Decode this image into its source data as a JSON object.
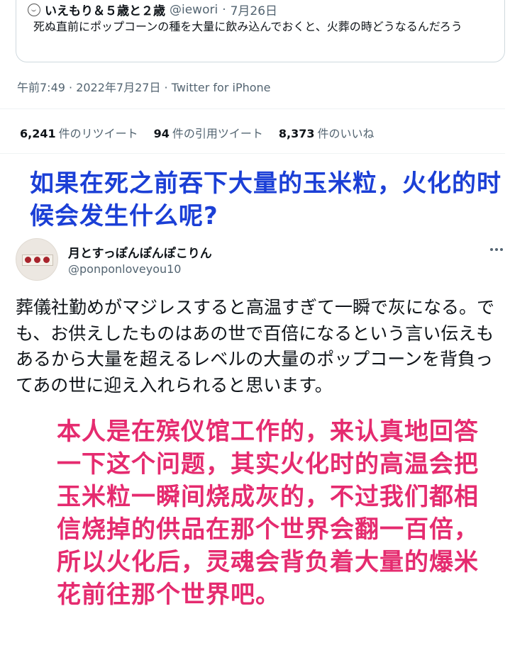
{
  "quoted_tweet": {
    "author_name": "いえもり＆５歳と２歳",
    "handle": "@iewori",
    "separator": "·",
    "date": "7月26日",
    "text": "死ぬ直前にポップコーンの種を大量に飲み込んでおくと、火葬の時どうなるんだろう"
  },
  "tweet_meta": {
    "timestamp": "午前7:49 · 2022年7月27日 · Twitter for iPhone",
    "retweets_count": "6,241",
    "retweets_label": "件のリツイート",
    "quotes_count": "94",
    "quotes_label": "件の引用ツイート",
    "likes_count": "8,373",
    "likes_label": "件のいいね"
  },
  "blue_caption": "如果在死之前吞下大量的玉米粒，火化的时候会发生什么呢?",
  "reply_tweet": {
    "author_name": "月とすっぽんぽんぽこりん",
    "handle": "@ponponloveyou10",
    "text": "葬儀社勤めがマジレスすると高温すぎて一瞬で灰になる。でも、お供えしたものはあの世で百倍になるという言い伝えもあるから大量を超えるレベルの大量のポップコーンを背負ってあの世に迎え入れられると思います。"
  },
  "pink_caption": "本人是在殡仪馆工作的，来认真地回答一下这个问题，其实火化时的高温会把玉米粒一瞬间烧成灰的，不过我们都相信烧掉的供品在那个世界会翻一百倍，所以火化后，灵魂会背负着大量的爆米花前往那个世界吧。",
  "icons": {
    "quote_avatar": "smiley-avatar-icon",
    "more": "more-dots-icon"
  },
  "colors": {
    "blue_caption": "#1b3fd6",
    "pink_caption": "#e52b6f",
    "secondary_text": "#536471"
  }
}
